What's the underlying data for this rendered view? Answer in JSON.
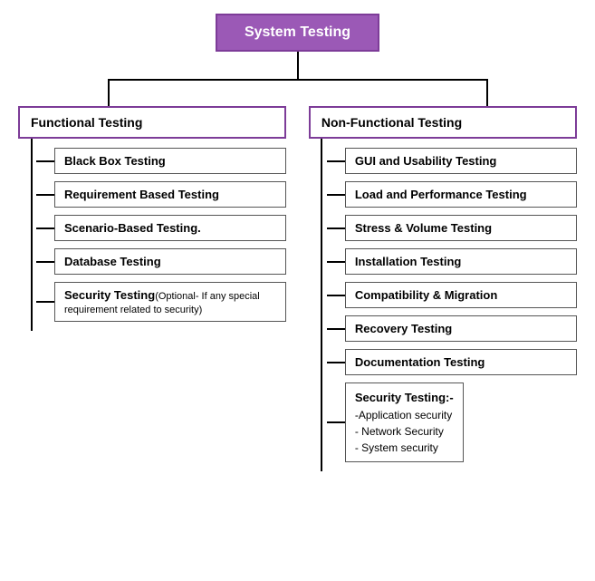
{
  "title": "System Testing",
  "left_category": "Functional Testing",
  "right_category": "Non-Functional Testing",
  "left_items": [
    {
      "id": "black-box",
      "main": "Black Box Testing",
      "sub": ""
    },
    {
      "id": "requirement-based",
      "main": "Requirement Based Testing",
      "sub": ""
    },
    {
      "id": "scenario-based",
      "main": "Scenario-Based Testing.",
      "sub": ""
    },
    {
      "id": "database",
      "main": "Database Testing",
      "sub": ""
    },
    {
      "id": "security-left",
      "main": "Security Testing",
      "sub": "(Optional- If any special requirement related to security)"
    }
  ],
  "right_items": [
    {
      "id": "gui",
      "main": "GUI and Usability Testing",
      "sub": ""
    },
    {
      "id": "load",
      "main": "Load and Performance Testing",
      "sub": ""
    },
    {
      "id": "stress",
      "main": "Stress & Volume Testing",
      "sub": ""
    },
    {
      "id": "installation",
      "main": "Installation Testing",
      "sub": ""
    },
    {
      "id": "compatibility",
      "main": "Compatibility & Migration",
      "sub": ""
    },
    {
      "id": "recovery",
      "main": "Recovery Testing",
      "sub": ""
    },
    {
      "id": "documentation",
      "main": "Documentation Testing",
      "sub": ""
    }
  ],
  "right_security": {
    "title": "Security Testing:-",
    "items": [
      "-Application security",
      "- Network Security",
      "- System security"
    ]
  }
}
